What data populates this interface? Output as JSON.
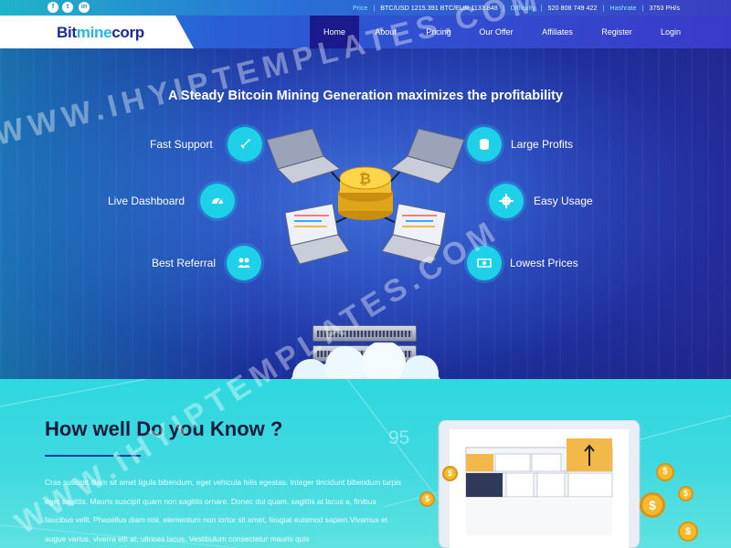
{
  "topbar": {
    "social": [
      "f",
      "t",
      "in"
    ],
    "price_label": "Price",
    "price_value": "BTC/USD 1215.391 BTC/EUR 1133.848",
    "difficulty_label": "Difficulty",
    "difficulty_value": "520 808 749 422",
    "hashrate_label": "Hashrate",
    "hashrate_value": "3753 PH/s"
  },
  "header": {
    "logo_part1": "Bit",
    "logo_part2": "mine",
    "logo_part3": "corp",
    "nav": [
      "Home",
      "About",
      "Pricing",
      "Our Offer",
      "Affiliates",
      "Register",
      "Login"
    ],
    "active_nav": "Home"
  },
  "hero": {
    "title": "A Steady Bitcoin Mining Generation maximizes the profitability",
    "features": [
      {
        "label": "Fast Support",
        "icon": "rocket-icon"
      },
      {
        "label": "Live Dashboard",
        "icon": "gauge-icon"
      },
      {
        "label": "Best Referral",
        "icon": "users-icon"
      },
      {
        "label": "Large Profits",
        "icon": "coins-icon"
      },
      {
        "label": "Easy Usage",
        "icon": "gear-icon"
      },
      {
        "label": "Lowest Prices",
        "icon": "money-icon"
      }
    ]
  },
  "bottom": {
    "title": "How well Do you Know ?",
    "paragraph": "Cras suscipit diam sit amet ligula bibendum, eget vehicula felis egestas. Integer tincidunt bibendum turpis eget sagittis. Mauris suscipit quam non sagittis ornare. Donec dui quam, sagittis at lacus a, finibus faucibus velit. Phasellus diam nisi, elementum non tortor sit amet, feugiat euismod sapien.Vivamus et augue varius, viverra elit at, ultrices lacus. Vestibulum consectetur mauris quis",
    "deco_number": "95",
    "coin_symbol": "$"
  },
  "watermark": {
    "text1": "WWW.IHYIPTEMPLATES.COM",
    "text2": "WWW.IHYIPTEMPLATES.COM"
  },
  "colors": {
    "accent": "#1ed0e8",
    "nav_active": "#1b1a8c",
    "bottom_bg": "#3fd9e0"
  }
}
